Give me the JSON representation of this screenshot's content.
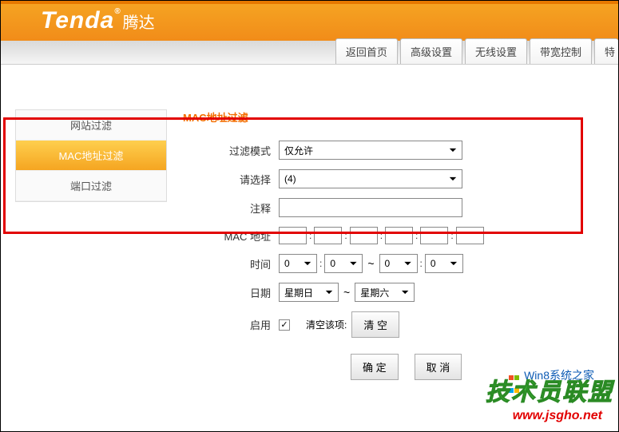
{
  "brand": {
    "logo": "Tenda",
    "cn": "腾达"
  },
  "nav": {
    "items": [
      "返回首页",
      "高级设置",
      "无线设置",
      "带宽控制",
      "特"
    ]
  },
  "sidebar": {
    "items": [
      {
        "label": "网站过滤",
        "active": false
      },
      {
        "label": "MAC地址过滤",
        "active": true
      },
      {
        "label": "端口过滤",
        "active": false
      }
    ]
  },
  "form": {
    "title": "MAC地址过滤",
    "labels": {
      "filter_mode": "过滤模式",
      "please_select": "请选择",
      "comment": "注释",
      "mac": "MAC 地址",
      "time": "时间",
      "date": "日期",
      "enable": "启用",
      "clear_label": "清空该项:"
    },
    "values": {
      "filter_mode": "仅允许",
      "please_select": "(4)",
      "comment": "",
      "mac": [
        "",
        "",
        "",
        "",
        "",
        ""
      ],
      "time_from_h": "0",
      "time_from_m": "0",
      "time_to_h": "0",
      "time_to_m": "0",
      "date_from": "星期日",
      "date_to": "星期六",
      "enable_checked": true
    },
    "buttons": {
      "clear": "清 空",
      "ok": "确 定",
      "cancel": "取 消"
    }
  },
  "watermarks": {
    "wm1": "技术员联盟",
    "wm2": "www.jsgho.net",
    "wm3": "Win8系统之家"
  }
}
